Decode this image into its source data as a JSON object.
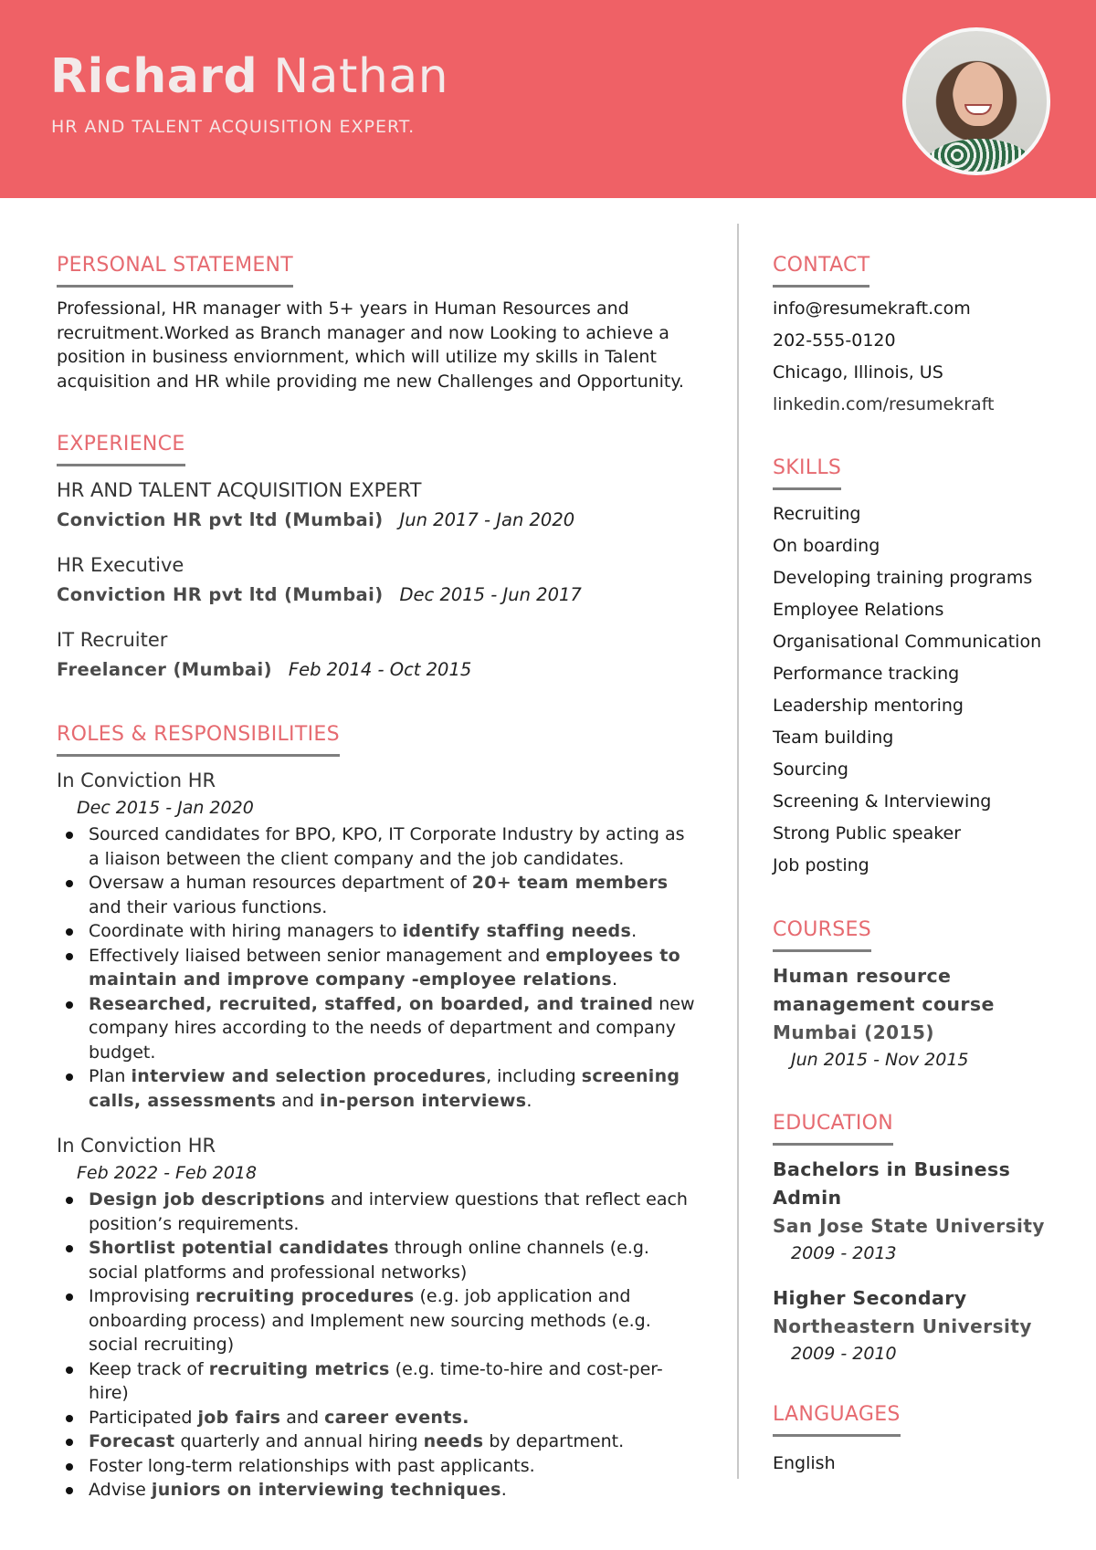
{
  "colors": {
    "header_bg": "#ef6166",
    "accent_heading": "#e66a70",
    "underline": "#7e7e7e"
  },
  "header": {
    "first_name": "Richard",
    "last_name": "Nathan",
    "title": "HR AND TALENT ACQUISITION EXPERT."
  },
  "sections": {
    "personal_statement": "PERSONAL STATEMENT",
    "experience": "EXPERIENCE",
    "roles": "ROLES & RESPONSIBILITIES",
    "contact": "CONTACT",
    "skills": "SKILLS",
    "courses": "COURSES",
    "education": "EDUCATION",
    "languages": "LANGUAGES"
  },
  "personal_statement": "Professional, HR manager with 5+ years in Human Resources and recruitment.Worked as Branch manager and now Looking to achieve a position in business enviornment, which will utilize my skills in Talent acquisition and HR while providing me new Challenges and Opportunity.",
  "experience": [
    {
      "title": "HR AND TALENT ACQUISITION EXPERT",
      "company": "Conviction HR pvt ltd (Mumbai)",
      "dates": "Jun 2017 - Jan 2020"
    },
    {
      "title": "HR Executive",
      "company": "Conviction HR pvt ltd (Mumbai)",
      "dates": "Dec 2015 - Jun 2017"
    },
    {
      "title": "IT Recruiter",
      "company": "Freelancer (Mumbai)",
      "dates": "Feb 2014 - Oct 2015"
    }
  ],
  "roles": [
    {
      "title": "In Conviction HR",
      "dates": "Dec 2015 - Jan 2020",
      "items": [
        [
          {
            "t": "Sourced candidates for BPO, KPO, IT Corporate Industry by acting as a liaison between the client company and the job candidates."
          }
        ],
        [
          {
            "t": "Oversaw a human resources department of "
          },
          {
            "t": "20+ team members",
            "b": true
          },
          {
            "t": " and their various functions."
          }
        ],
        [
          {
            "t": "Coordinate with hiring managers to "
          },
          {
            "t": "identify staffing needs",
            "b": true
          },
          {
            "t": "."
          }
        ],
        [
          {
            "t": "Effectively liaised between senior management and "
          },
          {
            "t": "employees to maintain and improve company -employee relations",
            "b": true
          },
          {
            "t": "."
          }
        ],
        [
          {
            "t": "Researched, recruited, staffed, on boarded, and trained",
            "b": true
          },
          {
            "t": " new company hires according to the needs of department and company budget."
          }
        ],
        [
          {
            "t": "Plan "
          },
          {
            "t": "interview and selection procedures",
            "b": true
          },
          {
            "t": ", including "
          },
          {
            "t": "screening calls, assessments",
            "b": true
          },
          {
            "t": " and "
          },
          {
            "t": "in-person interviews",
            "b": true
          },
          {
            "t": "."
          }
        ]
      ]
    },
    {
      "title": "In Conviction HR",
      "dates": "Feb 2022 - Feb 2018",
      "items": [
        [
          {
            "t": "Design job descriptions",
            "b": true
          },
          {
            "t": " and interview questions that reflect each position’s requirements."
          }
        ],
        [
          {
            "t": "Shortlist potential candidates",
            "b": true
          },
          {
            "t": " through online channels (e.g. social platforms and professional networks)"
          }
        ],
        [
          {
            "t": "Improvising "
          },
          {
            "t": "recruiting procedures",
            "b": true
          },
          {
            "t": " (e.g. job application and onboarding process) and Implement new sourcing methods (e.g. social recruiting)"
          }
        ],
        [
          {
            "t": "Keep track of "
          },
          {
            "t": "recruiting metrics",
            "b": true
          },
          {
            "t": " (e.g. time-to-hire and cost-per-hire)"
          }
        ],
        [
          {
            "t": "Participated "
          },
          {
            "t": "job fairs",
            "b": true
          },
          {
            "t": " and "
          },
          {
            "t": "career events.",
            "b": true
          }
        ],
        [
          {
            "t": "Forecast",
            "b": true
          },
          {
            "t": " quarterly and annual hiring "
          },
          {
            "t": "needs",
            "b": true
          },
          {
            "t": " by department."
          }
        ],
        [
          {
            "t": "Foster long-term relationships with past applicants."
          }
        ],
        [
          {
            "t": "Advise "
          },
          {
            "t": "juniors on interviewing techniques",
            "b": true
          },
          {
            "t": "."
          }
        ]
      ]
    }
  ],
  "contact": {
    "email": "info@resumekraft.com",
    "phone": "202-555-0120",
    "location": "Chicago, Illinois, US",
    "linkedin": "linkedin.com/resumekraft"
  },
  "skills": [
    "Recruiting",
    "On boarding",
    "Developing training programs",
    "Employee Relations",
    "Organisational Communication",
    "Performance tracking",
    "Leadership mentoring",
    "Team building",
    "Sourcing",
    "Screening & Interviewing",
    "Strong Public speaker",
    "Job posting"
  ],
  "courses": [
    {
      "name": "Human resource management course",
      "place": "Mumbai (2015)",
      "dates": "Jun 2015 - Nov 2015"
    }
  ],
  "education": [
    {
      "degree": "Bachelors in Business Admin",
      "school": "San Jose State University",
      "dates": "2009 - 2013"
    },
    {
      "degree": "Higher Secondary",
      "school": "Northeastern University",
      "dates": "2009 - 2010"
    }
  ],
  "languages": [
    "English"
  ]
}
